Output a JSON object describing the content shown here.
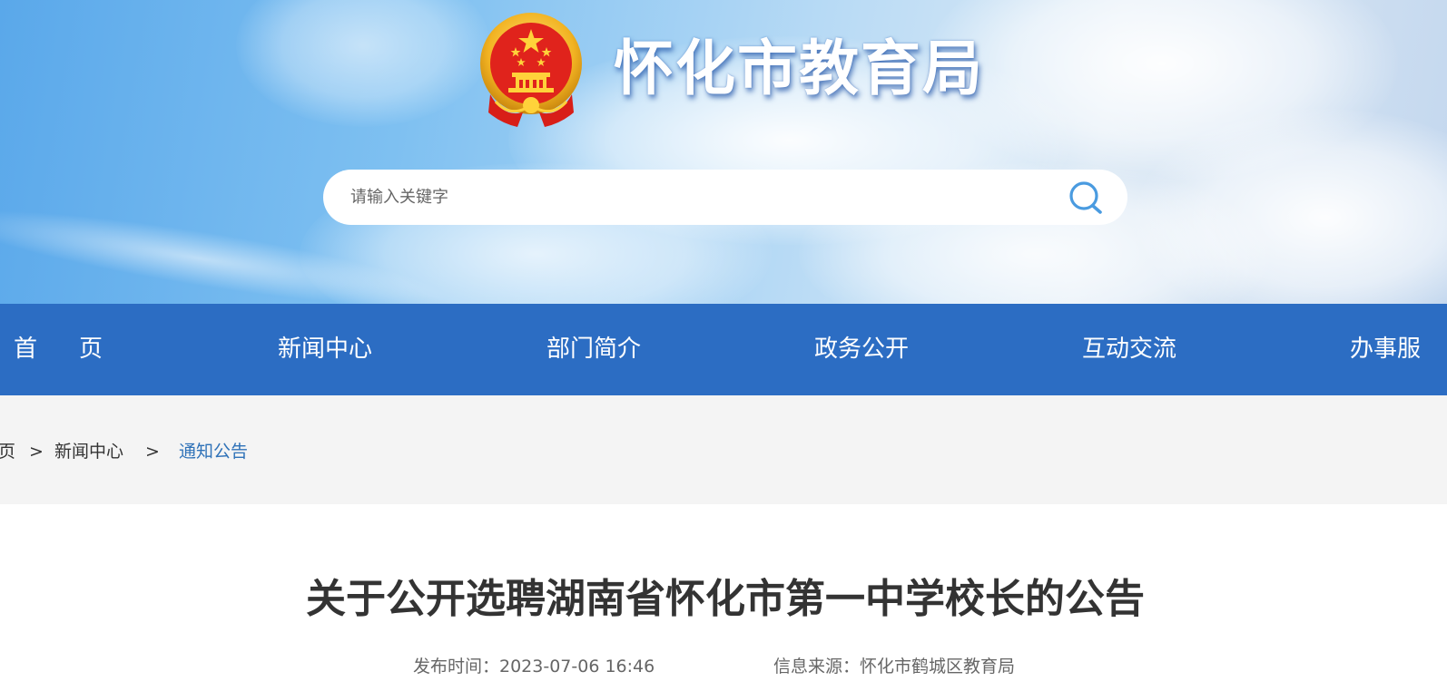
{
  "header": {
    "site_title": "怀化市教育局",
    "search": {
      "placeholder": "请输入关键字"
    }
  },
  "nav": {
    "items": [
      {
        "label_a": "首",
        "label_b": "页"
      },
      {
        "label": "新闻中心"
      },
      {
        "label": "部门简介"
      },
      {
        "label": "政务公开"
      },
      {
        "label": "互动交流"
      },
      {
        "label": "办事服"
      }
    ]
  },
  "breadcrumb": {
    "items": [
      "页",
      "新闻中心",
      "通知公告"
    ],
    "separator": ">"
  },
  "article": {
    "title": "关于公开选聘湖南省怀化市第一中学校长的公告",
    "publish_time": "发布时间：2023-07-06 16:46",
    "source": "信息来源：怀化市鹤城区教育局"
  },
  "colors": {
    "nav_bg": "#2c6dc3",
    "crumb_bg": "#f4f4f4",
    "crumb_current": "#2f72b8",
    "title_text": "#333333",
    "search_icon": "#4a9be0"
  },
  "icons": {
    "emblem": "national-emblem-icon",
    "search": "search-icon"
  }
}
